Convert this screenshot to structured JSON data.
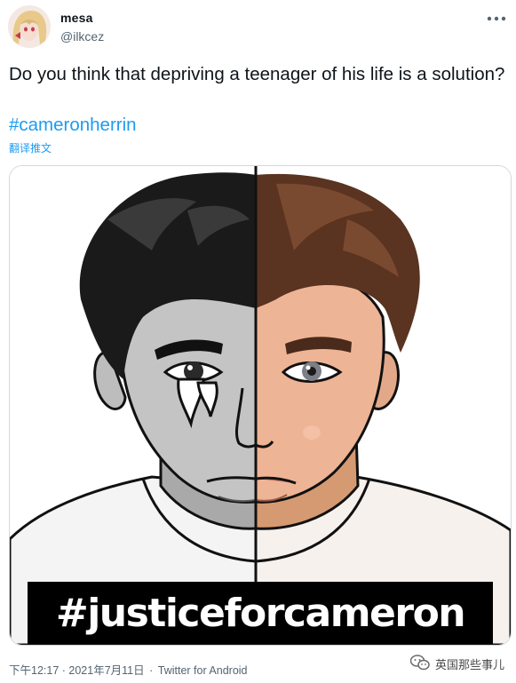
{
  "tweet": {
    "display_name": "mesa",
    "handle": "@ilkcez",
    "text": "Do you think that depriving a teenager of his life is a solution?",
    "hashtag": "#cameronherrin",
    "translate_label": "翻译推文",
    "media": {
      "banner_text": "#justiceforcameron"
    },
    "timestamp": "下午12:17 · 2021年7月11日",
    "separator": "·",
    "source": "Twitter for Android"
  },
  "watermark": {
    "text": "英国那些事儿",
    "icon": "wechat-icon"
  },
  "icons": {
    "more": "more-horizontal-icon",
    "avatar": "avatar-image"
  },
  "colors": {
    "link": "#1d9bf0",
    "secondary_text": "#536471",
    "primary_text": "#0f1419",
    "border": "#cfd9de"
  }
}
